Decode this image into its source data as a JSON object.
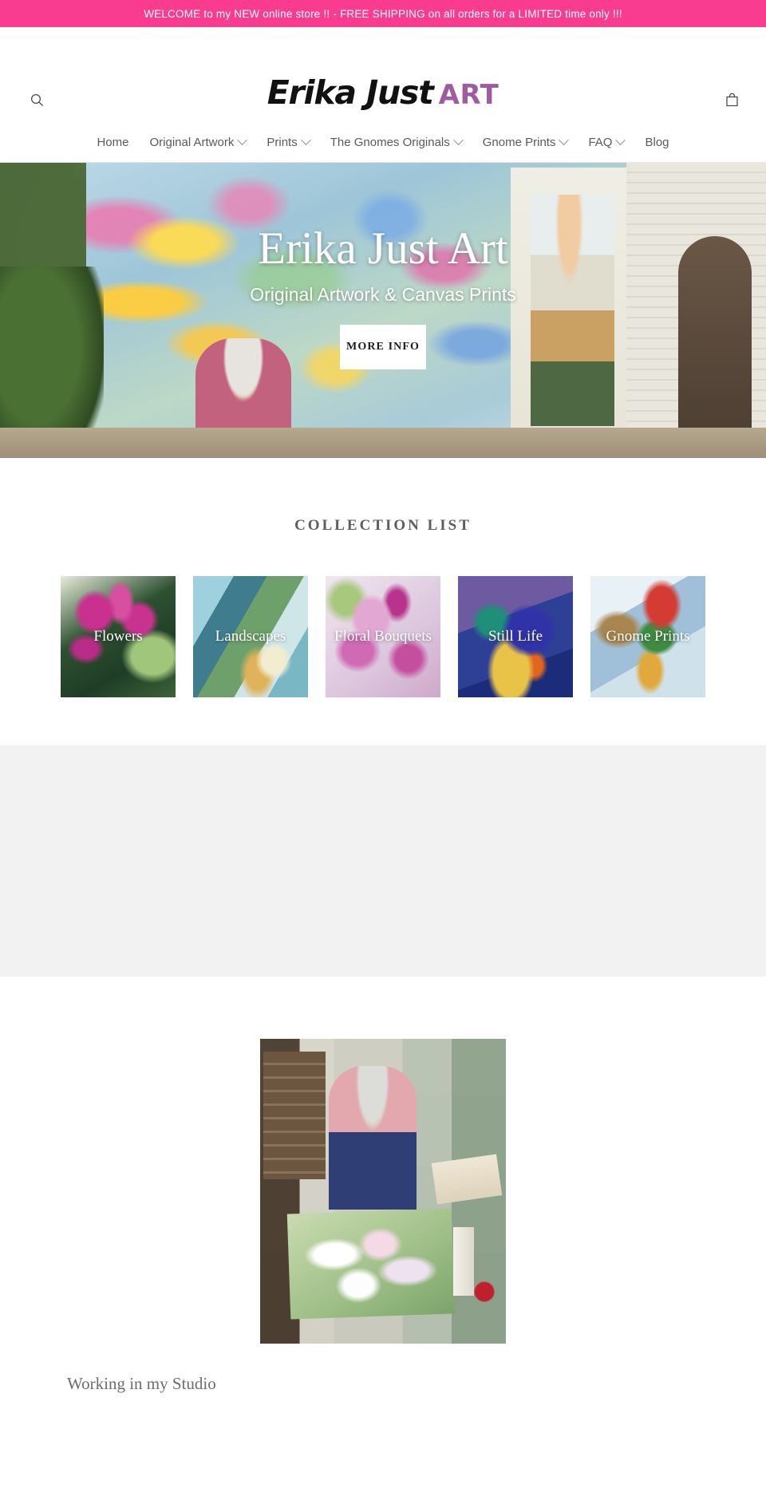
{
  "announcement": {
    "text": "WELCOME to my NEW online store !! - FREE SHIPPING on all orders for a LIMITED time only !!!",
    "background_color": "#f93c8f",
    "text_color": "#ffffff"
  },
  "header": {
    "search_icon": "search-icon",
    "cart_icon": "shopping-bag-icon",
    "logo": {
      "name_part": "Erika Just",
      "art_part": "ART",
      "name_color": "#111111",
      "art_color": "#9e5ba0"
    },
    "nav": [
      {
        "label": "Home",
        "has_dropdown": false
      },
      {
        "label": "Original Artwork",
        "has_dropdown": true
      },
      {
        "label": "Prints",
        "has_dropdown": true
      },
      {
        "label": "The Gnomes Originals",
        "has_dropdown": true
      },
      {
        "label": "Gnome Prints",
        "has_dropdown": true
      },
      {
        "label": "FAQ",
        "has_dropdown": true
      },
      {
        "label": "Blog",
        "has_dropdown": false
      }
    ]
  },
  "hero": {
    "title": "Erika Just Art",
    "subtitle": "Original Artwork & Canvas Prints",
    "button_label": "MORE INFO"
  },
  "collections": {
    "title": "COLLECTION LIST",
    "items": [
      {
        "label": "Flowers",
        "image_class": "img-flowers"
      },
      {
        "label": "Landscapes",
        "image_class": "img-landscapes"
      },
      {
        "label": "Floral Bouquets",
        "image_class": "img-bouquets"
      },
      {
        "label": "Still Life",
        "image_class": "img-stilllife"
      },
      {
        "label": "Gnome Prints",
        "image_class": "img-gnome"
      }
    ]
  },
  "studio": {
    "caption": "Working in my Studio"
  }
}
